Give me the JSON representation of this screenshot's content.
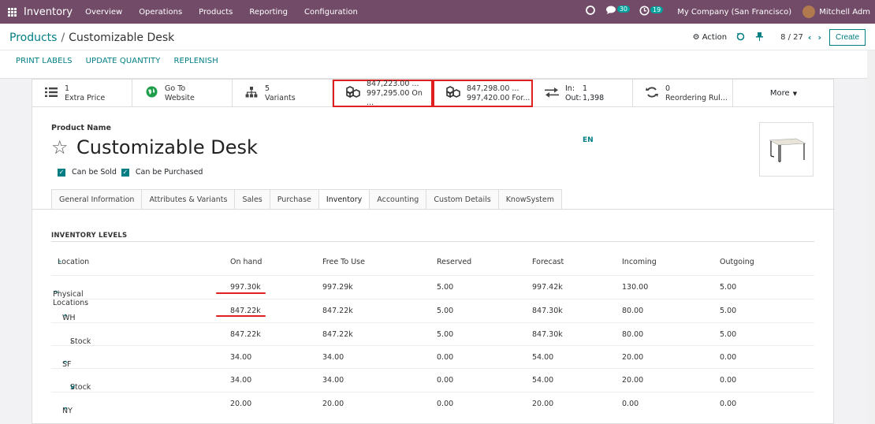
{
  "topbar": {
    "app_name": "Inventory",
    "menu": [
      "Overview",
      "Operations",
      "Products",
      "Reporting",
      "Configuration"
    ],
    "messages_count": "30",
    "activities_count": "19",
    "company": "My Company (San Francisco)",
    "user": "Mitchell Adm"
  },
  "breadcrumb": {
    "parent": "Products",
    "current": "Customizable Desk"
  },
  "control": {
    "action_label": "Action",
    "pager": "8 / 27",
    "create_label": "Create"
  },
  "header_buttons": [
    "PRINT LABELS",
    "UPDATE QUANTITY",
    "REPLENISH"
  ],
  "stat_buttons": {
    "extra_price": {
      "value": "1",
      "label": "Extra Price"
    },
    "website": {
      "line1": "Go To",
      "line2": "Website"
    },
    "variants": {
      "value": "5",
      "label": "Variants"
    },
    "on_hand": {
      "line1": "847,223.00 ...",
      "line2": "997,295.00 On ..."
    },
    "forecast": {
      "line1": "847,298.00 ...",
      "line2": "997,420.00 For..."
    },
    "in_out": {
      "in_label": "In:",
      "in_value": "1",
      "out_label": "Out:",
      "out_value": "1,398"
    },
    "reordering": {
      "value": "0",
      "label": "Reordering Rul..."
    },
    "more_label": "More"
  },
  "product": {
    "name_label": "Product Name",
    "name": "Customizable Desk",
    "lang": "EN",
    "can_be_sold": "Can be Sold",
    "can_be_purchased": "Can be Purchased"
  },
  "tabs": [
    "General Information",
    "Attributes & Variants",
    "Sales",
    "Purchase",
    "Inventory",
    "Accounting",
    "Custom Details",
    "KnowSystem"
  ],
  "active_tab": "Inventory",
  "inventory": {
    "title": "INVENTORY LEVELS",
    "columns": [
      "Location",
      "On hand",
      "Free To Use",
      "Reserved",
      "Forecast",
      "Incoming",
      "Outgoing"
    ],
    "rows": [
      {
        "location": "Physical Locations",
        "on_hand": "997.30k",
        "free": "997.29k",
        "reserved": "5.00",
        "forecast": "997.42k",
        "incoming": "130.00",
        "outgoing": "5.00"
      },
      {
        "location": "WH",
        "on_hand": "847.22k",
        "free": "847.22k",
        "reserved": "5.00",
        "forecast": "847.30k",
        "incoming": "80.00",
        "outgoing": "5.00"
      },
      {
        "location": "Stock",
        "on_hand": "847.22k",
        "free": "847.22k",
        "reserved": "5.00",
        "forecast": "847.30k",
        "incoming": "80.00",
        "outgoing": "5.00"
      },
      {
        "location": "SF",
        "on_hand": "34.00",
        "free": "34.00",
        "reserved": "0.00",
        "forecast": "54.00",
        "incoming": "20.00",
        "outgoing": "0.00"
      },
      {
        "location": "Stock",
        "on_hand": "34.00",
        "free": "34.00",
        "reserved": "0.00",
        "forecast": "54.00",
        "incoming": "20.00",
        "outgoing": "0.00"
      },
      {
        "location": "NY",
        "on_hand": "20.00",
        "free": "20.00",
        "reserved": "0.00",
        "forecast": "20.00",
        "incoming": "0.00",
        "outgoing": "0.00"
      }
    ]
  },
  "colors": {
    "topbar": "#714b67",
    "accent": "#017e84",
    "highlight": "#e0201e"
  }
}
